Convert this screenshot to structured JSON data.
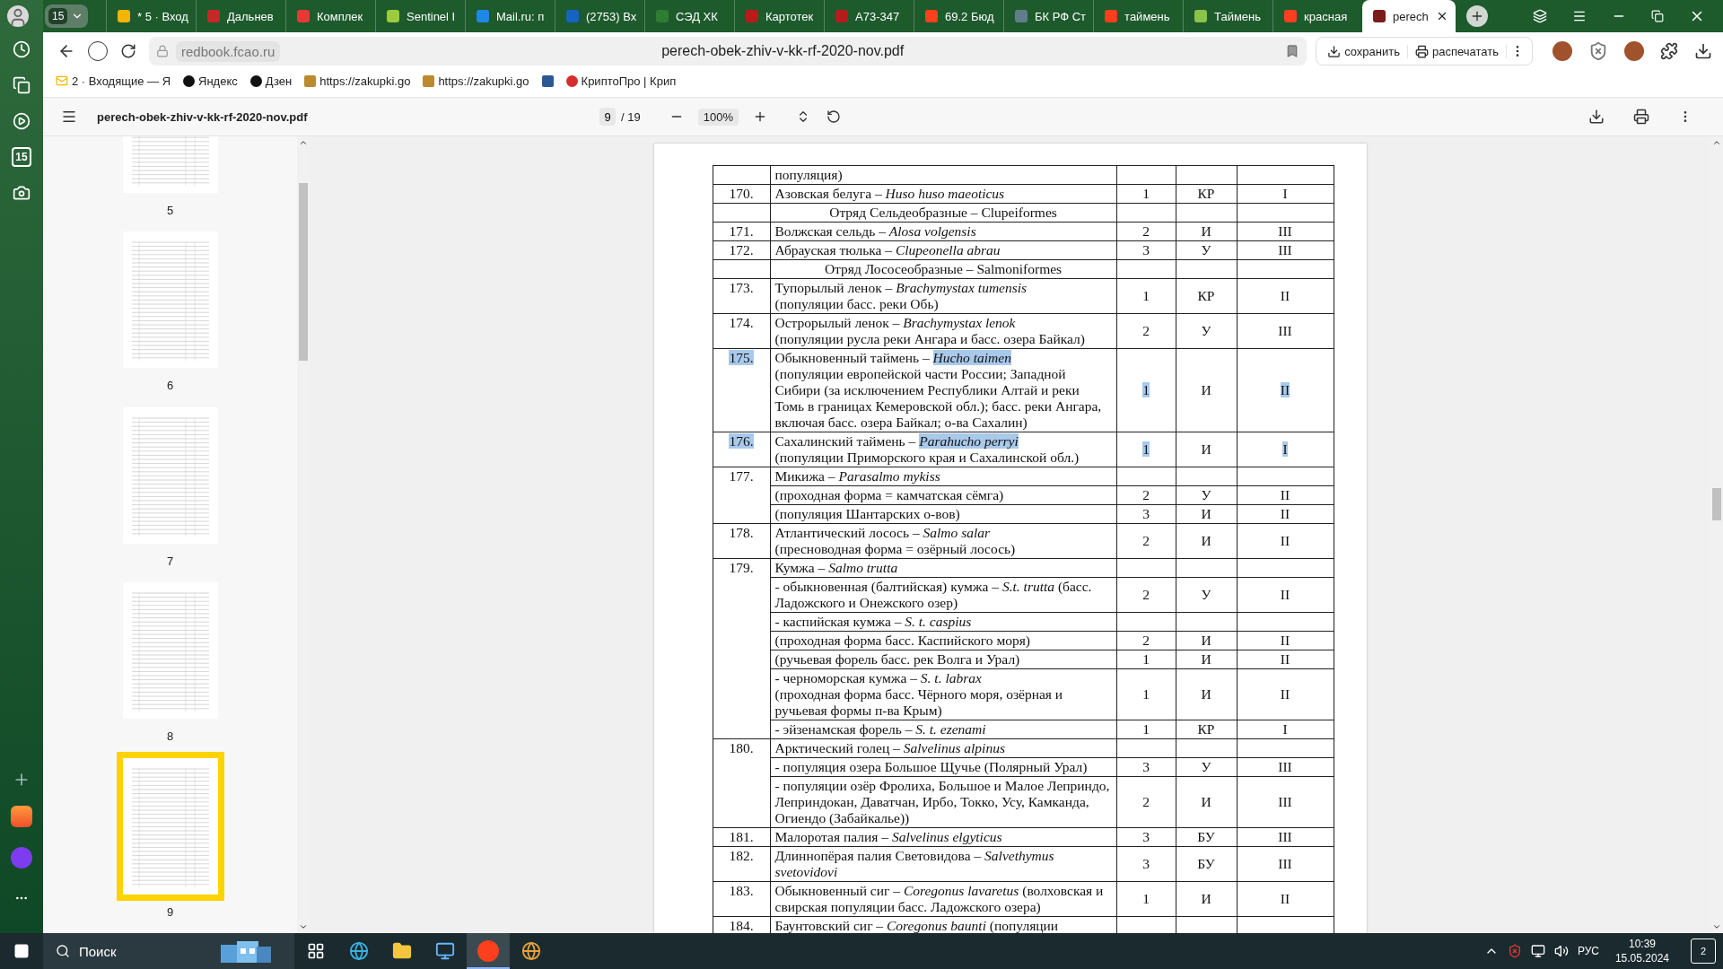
{
  "browser": {
    "tab_group_count": "15",
    "tabs": [
      {
        "label": "* 5 · Вход",
        "selected": false,
        "color": "#f4b400"
      },
      {
        "label": "Дальнев",
        "selected": false,
        "color": "#c62828"
      },
      {
        "label": "Комплек",
        "selected": false,
        "color": "#e53935"
      },
      {
        "label": "Sentinel I",
        "selected": false,
        "color": "#9ccc3a"
      },
      {
        "label": "Mail.ru: п",
        "selected": false,
        "color": "#1e88e5"
      },
      {
        "label": "(2753) Вх",
        "selected": false,
        "color": "#1565c0"
      },
      {
        "label": "СЭД ХК",
        "selected": false,
        "color": "#2e7d32"
      },
      {
        "label": "Картотек",
        "selected": false,
        "color": "#b71c1c"
      },
      {
        "label": "А73-347",
        "selected": false,
        "color": "#b71c1c"
      },
      {
        "label": "69.2 Бюд",
        "selected": false,
        "color": "#fc3f1d"
      },
      {
        "label": "БК РФ Ст",
        "selected": false,
        "color": "#607d8b"
      },
      {
        "label": "таймень",
        "selected": false,
        "color": "#fc3f1d"
      },
      {
        "label": "Таймень",
        "selected": false,
        "color": "#8bc34a"
      },
      {
        "label": "красная",
        "selected": false,
        "color": "#fc3f1d"
      },
      {
        "label": "perech",
        "selected": true,
        "color": "#7b1c1c"
      }
    ],
    "url": "redbook.fcao.ru",
    "title": "perech-obek-zhiv-v-kk-rf-2020-nov.pdf",
    "actions": [
      {
        "kind": "save",
        "label": "сохранить"
      },
      {
        "kind": "print",
        "label": "распечатать"
      }
    ],
    "bookmarks": [
      {
        "kind": "mail",
        "label": "2 · Входящие — Я"
      },
      {
        "kind": "site",
        "label": "Яндекс"
      },
      {
        "kind": "site",
        "label": "Дзен"
      },
      {
        "kind": "emblem",
        "label": "https://zakupki.go"
      },
      {
        "kind": "emblem",
        "label": "https://zakupki.go"
      },
      {
        "kind": "document"
      },
      {
        "kind": "crypto",
        "label": "КриптоПро | Крип"
      }
    ]
  },
  "side_rail": {
    "calendar_day": "15"
  },
  "pdf_toolbar": {
    "filename": "perech-obek-zhiv-v-kk-rf-2020-nov.pdf",
    "page": "9",
    "page_total": "/ 19",
    "zoom": "100%"
  },
  "thumbnails": [
    {
      "label": "5",
      "selected": false
    },
    {
      "label": "6",
      "selected": false
    },
    {
      "label": "7",
      "selected": false
    },
    {
      "label": "8",
      "selected": false
    },
    {
      "label": "9",
      "selected": true
    }
  ],
  "table": {
    "rows": [
      {
        "kind": "entry",
        "lines": [
          {
            "name": "популяция)"
          }
        ]
      },
      {
        "kind": "entry",
        "number": "170.",
        "highlighted": false,
        "lines": [
          {
            "name": "Азовская белуга – *Huso huso maeoticus*",
            "column_3": "1",
            "column_4": "КР",
            "column_5": "I"
          }
        ]
      },
      {
        "kind": "heading",
        "name": "Отряд Сельдеобразные – Clupeiformes"
      },
      {
        "kind": "entry",
        "number": "171.",
        "highlighted": false,
        "lines": [
          {
            "name": "Волжская сельдь – *Alosa volgensis*",
            "column_3": "2",
            "column_4": "И",
            "column_5": "III"
          }
        ]
      },
      {
        "kind": "entry",
        "number": "172.",
        "highlighted": false,
        "lines": [
          {
            "name": "Абрауская тюлька – *Clupeonella abrau*",
            "column_3": "3",
            "column_4": "У",
            "column_5": "III"
          }
        ]
      },
      {
        "kind": "heading",
        "name": "Отряд Лососеобразные – Salmoniformes"
      },
      {
        "kind": "entry",
        "number": "173.",
        "highlighted": false,
        "lines": [
          {
            "name": "Тупорылый ленок – *Brachymystax tumensis*\n(популяции басс. реки Обь)",
            "column_3": "1",
            "column_4": "КР",
            "column_5": "II"
          }
        ]
      },
      {
        "kind": "entry",
        "number": "174.",
        "highlighted": false,
        "lines": [
          {
            "name": "Острорылый ленок – *Brachymystax lenok*\n(популяции русла реки Ангара и басс. озера Байкал)",
            "column_3": "2",
            "column_4": "У",
            "column_5": "III"
          }
        ]
      },
      {
        "kind": "entry",
        "number": "175.",
        "highlighted": true,
        "lines": [
          {
            "name": "Обыкновенный таймень – *Hucho taimen*\n(популяции европейской части России; Западной Сибири (за исключением Республики Алтай и реки Томь в границах Кемеровской обл.); басс. реки Ангара, включая басс. озера Байкал; о-ва Сахалин)",
            "column_3": "1",
            "column_4": "И",
            "column_5": "II"
          }
        ]
      },
      {
        "kind": "entry",
        "number": "176.",
        "highlighted": true,
        "lines": [
          {
            "name": "Сахалинский таймень – *Parahucho perryi*\n(популяции Приморского края и Сахалинской обл.)",
            "column_3": "1",
            "column_4": "И",
            "column_5": "I"
          }
        ]
      },
      {
        "kind": "entry",
        "number": "177.",
        "highlighted": false,
        "lines": [
          {
            "name": "Микижа – *Parasalmo mykiss*"
          },
          {
            "name": "(проходная форма = камчатская сёмга)",
            "column_3": "2",
            "column_4": "У",
            "column_5": "II"
          },
          {
            "name": "(популяция Шантарских о-вов)",
            "column_3": "3",
            "column_4": "И",
            "column_5": "II"
          }
        ]
      },
      {
        "kind": "entry",
        "number": "178.",
        "highlighted": false,
        "lines": [
          {
            "name": "Атлантический лосось – *Salmo salar*\n(пресноводная форма = озёрный лосось)",
            "column_3": "2",
            "column_4": "И",
            "column_5": "II"
          }
        ]
      },
      {
        "kind": "entry",
        "number": "179.",
        "highlighted": false,
        "lines": [
          {
            "name": "Кумжа – *Salmo trutta*"
          },
          {
            "name": "- обыкновенная (балтийская) кумжа – *S.t. trutta* (басс. Ладожского и Онежского озер)",
            "column_3": "2",
            "column_4": "У",
            "column_5": "II"
          },
          {
            "name": "- каспийская кумжа – *S. t. caspius*"
          },
          {
            "name": "(проходная форма басс. Каспийского моря)",
            "column_3": "2",
            "column_4": "И",
            "column_5": "II"
          },
          {
            "name": "(ручьевая форель басс. рек Волга и Урал)",
            "column_3": "1",
            "column_4": "И",
            "column_5": "II"
          },
          {
            "name": "- черноморская кумжа – *S. t. labrax*\n(проходная форма басс. Чёрного моря, озёрная и ручьевая формы п-ва Крым)",
            "column_3": "1",
            "column_4": "И",
            "column_5": "II"
          },
          {
            "name": "- эйзенамская форель – *S. t. ezenami*",
            "column_3": "1",
            "column_4": "КР",
            "column_5": "I"
          }
        ]
      },
      {
        "kind": "entry",
        "number": "180.",
        "highlighted": false,
        "lines": [
          {
            "name": "Арктический голец – *Salvelinus alpinus*"
          },
          {
            "name": "- популяция озера Большое Щучье (Полярный Урал)",
            "column_3": "3",
            "column_4": "У",
            "column_5": "III"
          },
          {
            "name": "- популяции озёр Фролиха, Большое и Малое Леприндо, Леприндокан, Даватчан, Ирбо, Токко, Усу, Камканда, Огиендо (Забайкалье))",
            "column_3": "2",
            "column_4": "И",
            "column_5": "III"
          }
        ]
      },
      {
        "kind": "entry",
        "number": "181.",
        "highlighted": false,
        "lines": [
          {
            "name": "Малоротая палия – *Salvelinus elgyticus*",
            "column_3": "3",
            "column_4": "БУ",
            "column_5": "III"
          }
        ]
      },
      {
        "kind": "entry",
        "number": "182.",
        "highlighted": false,
        "lines": [
          {
            "name": "Длиннопёрая палия Световидова – *Salvethymus svetovidovi*",
            "column_3": "3",
            "column_4": "БУ",
            "column_5": "III"
          }
        ]
      },
      {
        "kind": "entry",
        "number": "183.",
        "highlighted": false,
        "lines": [
          {
            "name": "Обыкновенный сиг – *Coregonus lavaretus* (волховская и свирская популяции басс. Ладожского озера)",
            "column_3": "1",
            "column_4": "И",
            "column_5": "II"
          }
        ]
      },
      {
        "kind": "entry",
        "number": "184.",
        "highlighted": false,
        "lines": [
          {
            "name": "Баунтовский сиг – *Coregonus baunti* (популяции"
          }
        ]
      }
    ]
  },
  "taskbar": {
    "search_placeholder": "Поиск",
    "apps": [
      {
        "kind": "task-view",
        "selected": false
      },
      {
        "kind": "edge",
        "selected": false
      },
      {
        "kind": "explorer",
        "selected": false
      },
      {
        "kind": "control-panel",
        "selected": false
      },
      {
        "kind": "yandex",
        "selected": true
      },
      {
        "kind": "globe",
        "selected": false
      }
    ],
    "language": "РУС",
    "time": "10:39",
    "date": "15.05.2024",
    "notifications": "2"
  }
}
